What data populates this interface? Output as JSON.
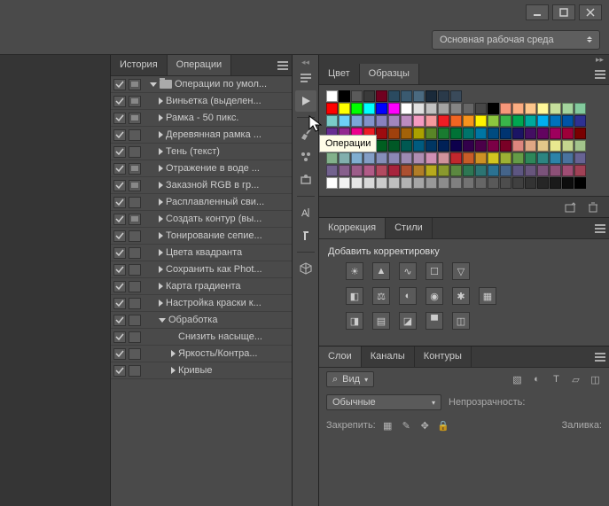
{
  "window": {
    "minimize": "_",
    "maximize": "▢",
    "close": "×"
  },
  "workspace": {
    "label": "Основная рабочая среда"
  },
  "tabs": {
    "history": "История",
    "actions": "Операции"
  },
  "action_set": "Операции по умол...",
  "actions": [
    {
      "label": "Виньетка (выделен...",
      "modal": true
    },
    {
      "label": "Рамка - 50 пикс.",
      "modal": true
    },
    {
      "label": "Деревянная рамка ...",
      "modal": false
    },
    {
      "label": "Тень (текст)",
      "modal": false
    },
    {
      "label": "Отражение в воде ...",
      "modal": true
    },
    {
      "label": "Заказной RGB в гр...",
      "modal": true
    },
    {
      "label": "Расплавленный сви...",
      "modal": false
    },
    {
      "label": "Создать контур (вы...",
      "modal": true
    },
    {
      "label": "Тонирование сепие...",
      "modal": false
    },
    {
      "label": "Цвета квадранта",
      "modal": false
    },
    {
      "label": "Сохранить как Phot...",
      "modal": false
    },
    {
      "label": "Карта градиента",
      "modal": false
    },
    {
      "label": "Настройка краски к...",
      "modal": false
    }
  ],
  "action_exp": {
    "label": "Обработка"
  },
  "sub_actions": [
    {
      "label": "Снизить насыще...",
      "tri": false
    },
    {
      "label": "Яркость/Контра...",
      "tri": true
    },
    {
      "label": "Кривые",
      "tri": true
    }
  ],
  "tooltip": "Операции",
  "color_tabs": {
    "color": "Цвет",
    "swatches": "Образцы"
  },
  "adj_tabs": {
    "corr": "Коррекция",
    "styles": "Стили"
  },
  "adj_title": "Добавить корректировку",
  "layer_tabs": {
    "layers": "Слои",
    "channels": "Каналы",
    "paths": "Контуры"
  },
  "layer_filter": "Вид",
  "blend_mode": "Обычные",
  "opacity_label": "Непрозрачность:",
  "lock_label": "Закрепить:",
  "fill_label": "Заливка:",
  "search_icon": "⌕",
  "chart_data": null,
  "swatches_basic": [
    "#ffffff",
    "#000000",
    "#5a5a5a",
    "#3a3a3a",
    "#700020",
    "#2a4a60",
    "#3a5a70",
    "#4a6a80",
    "#1a2a3a",
    "#2a3a4a",
    "#3a4a5a"
  ],
  "swatches": [
    "#ff0000",
    "#ffff00",
    "#00ff00",
    "#00ffff",
    "#0000ff",
    "#ff00ff",
    "#ffffff",
    "#e0e0e0",
    "#c2c2c2",
    "#a3a3a3",
    "#858585",
    "#666666",
    "#474747",
    "#000000",
    "#f7977a",
    "#fbad82",
    "#fdc68c",
    "#fff799",
    "#c6df9c",
    "#a4d49d",
    "#83ca9d",
    "#7accc8",
    "#6dcff6",
    "#7ca6d8",
    "#8293ca",
    "#8881be",
    "#a286bd",
    "#bc8cbf",
    "#f49bc1",
    "#f5999d",
    "#ee1d24",
    "#f16522",
    "#f7941d",
    "#fff200",
    "#8cc63f",
    "#39b54a",
    "#00a651",
    "#00a99d",
    "#00aeef",
    "#0072bc",
    "#0054a6",
    "#2e3192",
    "#662d91",
    "#92278f",
    "#ec008c",
    "#ed1c24",
    "#9e0b0f",
    "#a0410d",
    "#a36209",
    "#aba000",
    "#598527",
    "#197b30",
    "#007236",
    "#00746b",
    "#0076a3",
    "#004b80",
    "#003471",
    "#1b1464",
    "#440e62",
    "#630460",
    "#9e005d",
    "#9e0039",
    "#790000",
    "#7b2e00",
    "#7d4900",
    "#827b00",
    "#406618",
    "#005e20",
    "#005826",
    "#005952",
    "#005b7f",
    "#003663",
    "#002157",
    "#0d004c",
    "#32004b",
    "#4b0049",
    "#7b0046",
    "#7a0026",
    "#dd867e",
    "#e0a784",
    "#e4c78a",
    "#e8e88f",
    "#c5d68e",
    "#a3c48c",
    "#82b18b",
    "#81afad",
    "#80aed0",
    "#839ec5",
    "#858eb9",
    "#8b87b4",
    "#9c8ab2",
    "#ae8db1",
    "#cf90b4",
    "#d0929b",
    "#c1272d",
    "#c75c28",
    "#cd9124",
    "#d3c620",
    "#9cb134",
    "#659c47",
    "#2e875a",
    "#2d8581",
    "#2c83a8",
    "#4a739e",
    "#676393",
    "#72628e",
    "#875f8c",
    "#9c5d89",
    "#b15b87",
    "#b24a60",
    "#a7233c",
    "#ac5031",
    "#b17d27",
    "#b7aa1c",
    "#89992e",
    "#5b8840",
    "#2d7753",
    "#2c7573",
    "#2b7292",
    "#44648a",
    "#5d5681",
    "#67557c",
    "#7a527a",
    "#8d5077",
    "#a04d74",
    "#a14156",
    "#ffffff",
    "#f2f2f2",
    "#e6e6e6",
    "#d9d9d9",
    "#cccccc",
    "#bfbfbf",
    "#b3b3b3",
    "#a6a6a6",
    "#999999",
    "#8c8c8c",
    "#808080",
    "#737373",
    "#666666",
    "#595959",
    "#4d4d4d",
    "#404040",
    "#333333",
    "#262626",
    "#1a1a1a",
    "#0d0d0d",
    "#000000"
  ]
}
